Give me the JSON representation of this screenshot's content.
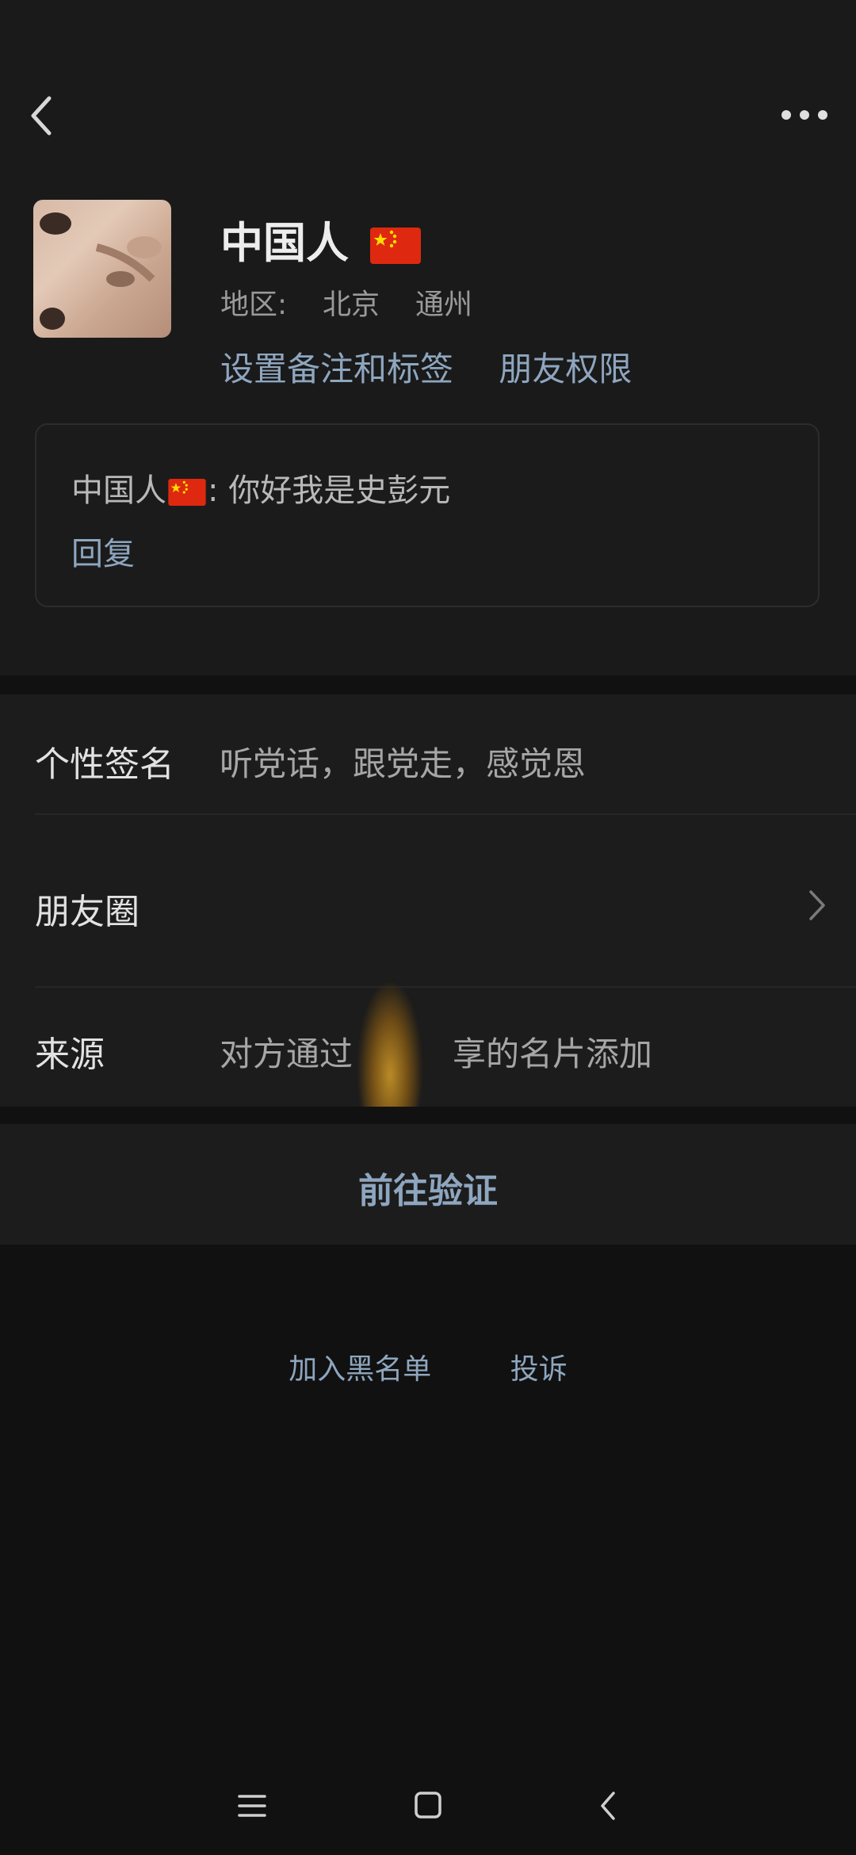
{
  "profile": {
    "name": "中国人",
    "flag_icon": "china-flag-icon",
    "region_label": "地区:",
    "region_city": "北京",
    "region_district": "通州",
    "set_remark_label": "设置备注和标签",
    "friend_permission_label": "朋友权限"
  },
  "message": {
    "sender": "中国人",
    "text": ": 你好我是史彭元",
    "reply_label": "回复"
  },
  "rows": {
    "signature_label": "个性签名",
    "signature_value": "听党话，跟党走，感觉恩",
    "moments_label": "朋友圈",
    "source_label": "来源",
    "source_value": "对方通过　　　享的名片添加"
  },
  "actions": {
    "verify_label": "前往验证",
    "blacklist_label": "加入黑名单",
    "report_label": "投诉"
  },
  "colors": {
    "background": "#1a1a1a",
    "accent_link": "#8ea6bf"
  }
}
